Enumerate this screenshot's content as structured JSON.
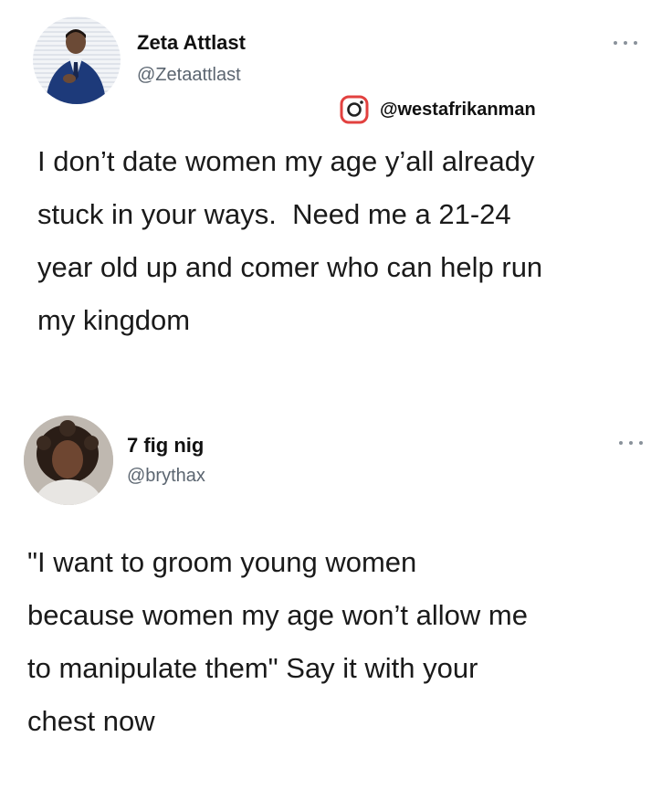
{
  "tweet1": {
    "name": "Zeta Attlast",
    "handle": "@Zetaattlast",
    "instagram_handle": "@westafrikanman",
    "text": "I don’t date women my age y’all already\nstuck in your ways.  Need me a 21-24\nyear old up and comer who can help run\nmy kingdom"
  },
  "tweet2": {
    "name": "7 fig nig",
    "handle": "@brythax",
    "text": "\"I want to groom young women\nbecause women my age won’t allow me\nto manipulate them\" Say it with your\nchest now"
  },
  "icons": {
    "more": "more-horizontal-icon",
    "instagram": "instagram-icon"
  }
}
